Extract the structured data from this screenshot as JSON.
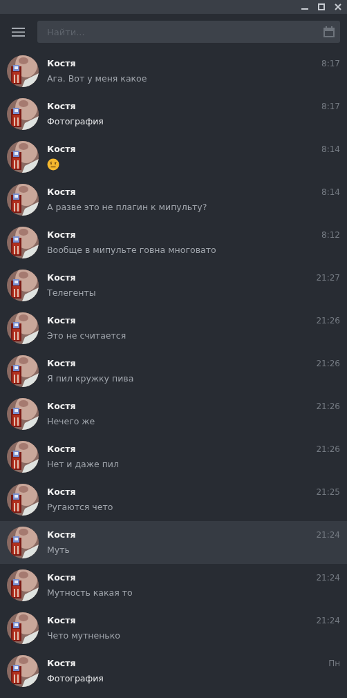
{
  "search": {
    "placeholder": "Найти..."
  },
  "chats": [
    {
      "name": "Костя",
      "time": "8:17",
      "kind": "text",
      "message": "Ага. Вот у меня какое",
      "selected": false
    },
    {
      "name": "Костя",
      "time": "8:17",
      "kind": "media",
      "message": "Фотография",
      "selected": false
    },
    {
      "name": "Костя",
      "time": "8:14",
      "kind": "emoji",
      "selected": false
    },
    {
      "name": "Костя",
      "time": "8:14",
      "kind": "text",
      "message": "А разве это не плагин к мипульту?",
      "selected": false
    },
    {
      "name": "Костя",
      "time": "8:12",
      "kind": "text",
      "message": "Вообще в мипульте говна многовато",
      "selected": false
    },
    {
      "name": "Костя",
      "time": "21:27",
      "kind": "text",
      "message": "Телегенты",
      "selected": false
    },
    {
      "name": "Костя",
      "time": "21:26",
      "kind": "text",
      "message": "Это не считается",
      "selected": false
    },
    {
      "name": "Костя",
      "time": "21:26",
      "kind": "text",
      "message": "Я пил кружку пива",
      "selected": false
    },
    {
      "name": "Костя",
      "time": "21:26",
      "kind": "text",
      "message": "Нечего же",
      "selected": false
    },
    {
      "name": "Костя",
      "time": "21:26",
      "kind": "text",
      "message": "Нет и даже пил",
      "selected": false
    },
    {
      "name": "Костя",
      "time": "21:25",
      "kind": "text",
      "message": "Ругаются чето",
      "selected": false
    },
    {
      "name": "Костя",
      "time": "21:24",
      "kind": "text",
      "message": "Муть",
      "selected": true
    },
    {
      "name": "Костя",
      "time": "21:24",
      "kind": "text",
      "message": "Мутность какая то",
      "selected": false
    },
    {
      "name": "Костя",
      "time": "21:24",
      "kind": "text",
      "message": "Чето мутненько",
      "selected": false
    },
    {
      "name": "Костя",
      "time": "Пн",
      "kind": "media",
      "message": "Фотография",
      "selected": false
    }
  ]
}
